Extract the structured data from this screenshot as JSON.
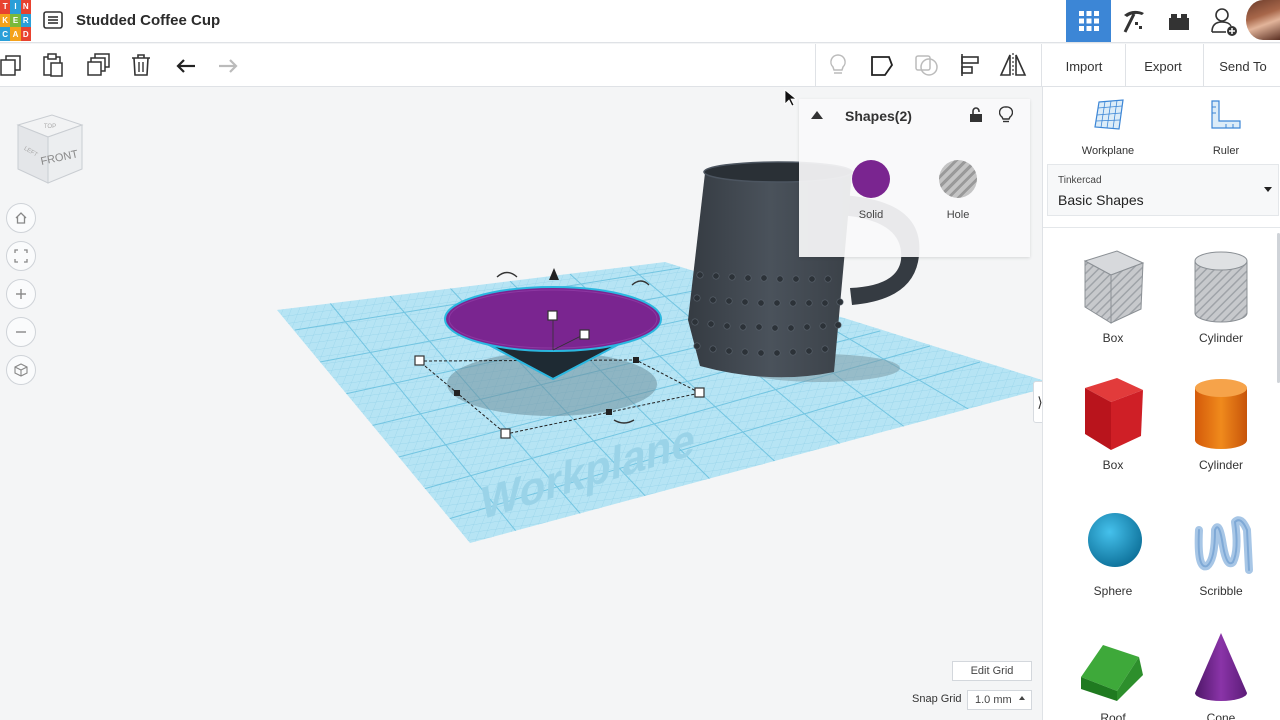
{
  "header": {
    "logo_letters": [
      "T",
      "I",
      "N",
      "K",
      "E",
      "R",
      "C",
      "A",
      "D"
    ],
    "title": "Studded Coffee Cup",
    "icons": [
      "design-list-icon",
      "grid-view-icon",
      "pickaxe-icon",
      "bricks-icon",
      "add-user-icon"
    ]
  },
  "toolbar": {
    "left_icons": [
      "copy-icon",
      "paste-icon",
      "duplicate-icon",
      "delete-icon",
      "undo-icon",
      "redo-icon"
    ],
    "right_icons": [
      "light-bulb-icon",
      "note-icon",
      "workplane-shape-icon",
      "align-icon",
      "mirror-icon"
    ],
    "import_label": "Import",
    "export_label": "Export",
    "send_to_label": "Send To"
  },
  "viewport": {
    "view_cube_face": "FRONT",
    "view_cube_top": "TOP",
    "view_cube_left": "LEFT",
    "workplane_label": "Workplane",
    "controls": [
      "home-icon",
      "fit-view-icon",
      "zoom-in-icon",
      "zoom-out-icon",
      "orthographic-icon"
    ]
  },
  "inspector": {
    "title": "Shapes(2)",
    "solid_label": "Solid",
    "hole_label": "Hole",
    "solid_color": "#7a2590"
  },
  "grid": {
    "edit_label": "Edit Grid",
    "snap_label": "Snap Grid",
    "snap_value": "1.0 mm"
  },
  "panel": {
    "workplane_label": "Workplane",
    "ruler_label": "Ruler",
    "library_small": "Tinkercad",
    "library_name": "Basic Shapes",
    "shapes": [
      {
        "label": "Box",
        "kind": "box-hole"
      },
      {
        "label": "Cylinder",
        "kind": "cylinder-hole"
      },
      {
        "label": "Box",
        "kind": "box-red"
      },
      {
        "label": "Cylinder",
        "kind": "cylinder-orange"
      },
      {
        "label": "Sphere",
        "kind": "sphere"
      },
      {
        "label": "Scribble",
        "kind": "scribble"
      },
      {
        "label": "Roof",
        "kind": "roof"
      },
      {
        "label": "Cone",
        "kind": "cone"
      }
    ]
  },
  "colors": {
    "accent": "#3c86d6",
    "workplane": "#a9dff1",
    "mug": "#3e454d",
    "solid": "#7a2590"
  }
}
